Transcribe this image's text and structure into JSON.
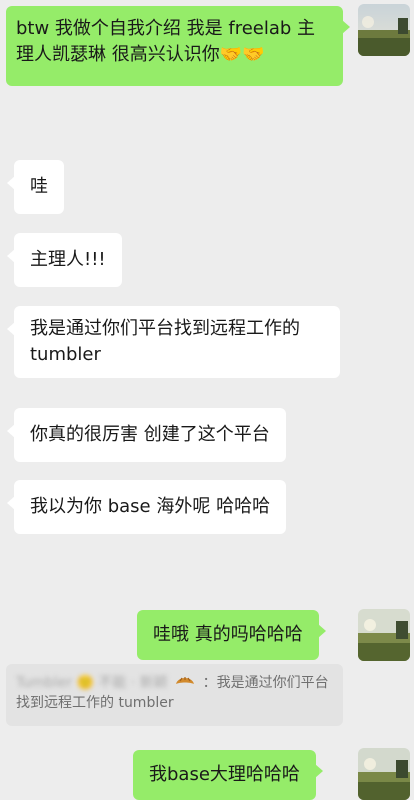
{
  "messages": [
    {
      "id": "m1",
      "direction": "out",
      "text": "btw 我做个自我介绍 我是 freelab 主理人凯瑟琳 很高兴认识你🤝🤝"
    },
    {
      "id": "m2",
      "direction": "in",
      "text": "哇"
    },
    {
      "id": "m3",
      "direction": "in",
      "text": "主理人!!!"
    },
    {
      "id": "m4",
      "direction": "in",
      "text": "我是通过你们平台找到远程工作的 tumbler"
    },
    {
      "id": "m5",
      "direction": "in",
      "text": "你真的很厉害 创建了这个平台"
    },
    {
      "id": "m6",
      "direction": "in",
      "text": "我以为你 base 海外呢 哈哈哈"
    },
    {
      "id": "m7",
      "direction": "out",
      "text": "哇哦 真的吗哈哈哈"
    },
    {
      "id": "m8",
      "direction": "out",
      "text": "我base大理哈哈哈"
    }
  ],
  "quoted_reply": {
    "sender_redacted": "Tumbler 🙂 不能 · 新颖",
    "emoji": "croissant",
    "text": "：我是通过你们平台找到远程工作的 tumbler"
  },
  "colors": {
    "background": "#ededed",
    "outgoing_bubble": "#95ec69",
    "incoming_bubble": "#ffffff",
    "quote_background": "#e3e3e3"
  }
}
